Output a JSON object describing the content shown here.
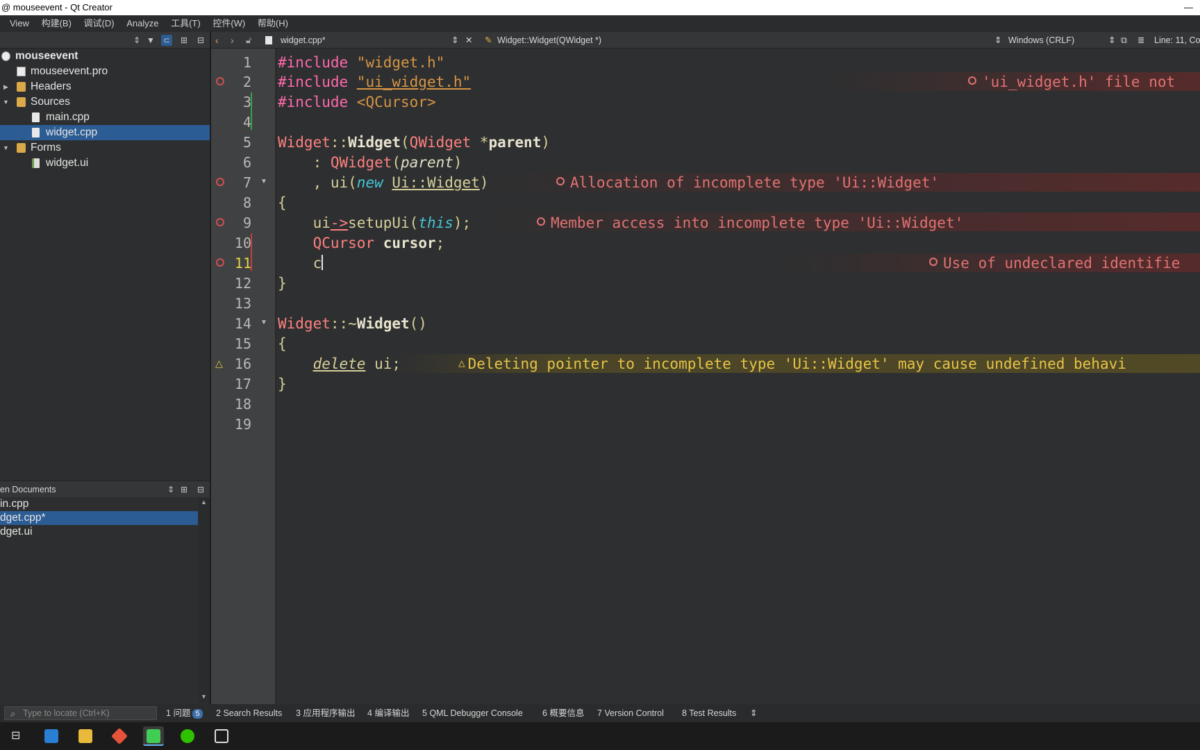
{
  "window": {
    "title": "@ mouseevent - Qt Creator"
  },
  "menu": [
    "View",
    "构建(B)",
    "调试(D)",
    "Analyze",
    "工具(T)",
    "控件(W)",
    "帮助(H)"
  ],
  "project_tree": [
    {
      "label": "mouseevent",
      "bold": true
    },
    {
      "label": "mouseevent.pro"
    },
    {
      "label": "Headers"
    },
    {
      "label": "Sources"
    },
    {
      "label": "main.cpp"
    },
    {
      "label": "widget.cpp",
      "selected": true
    },
    {
      "label": "Forms"
    },
    {
      "label": "widget.ui"
    }
  ],
  "open_documents": {
    "title": "en Documents",
    "items": [
      {
        "label": "in.cpp"
      },
      {
        "label": "dget.cpp*",
        "selected": true
      },
      {
        "label": "dget.ui"
      }
    ]
  },
  "editor_toolbar": {
    "file": "widget.cpp*",
    "symbol": "Widget::Widget(QWidget *)",
    "line_ending": "Windows (CRLF)",
    "position": "Line: 11, Co"
  },
  "editor": {
    "line_numbers": [
      "1",
      "2",
      "3",
      "4",
      "5",
      "6",
      "7",
      "8",
      "9",
      "10",
      "11",
      "12",
      "13",
      "14",
      "15",
      "16",
      "17",
      "18",
      "19"
    ],
    "current_line": 11,
    "diagnostics": {
      "d2": "'ui_widget.h' file not",
      "d7": "Allocation of incomplete type 'Ui::Widget'",
      "d9": "Member access into incomplete type 'Ui::Widget'",
      "d11": "Use of undeclared identifie",
      "d16": "Deleting pointer to incomplete type 'Ui::Widget' may cause undefined behavi"
    },
    "code": {
      "l1a": "#include ",
      "l1b": "\"widget.h\"",
      "l2a": "#include ",
      "l2b": "\"ui_widget.h\"",
      "l3a": "#include ",
      "l3b": "<QCursor>",
      "l5a": "Widget",
      "l5b": "::",
      "l5c": "Widget",
      "l5d": "(",
      "l5e": "QWidget",
      "l5f": " *",
      "l5g": "parent",
      "l5h": ")",
      "l6a": "    : ",
      "l6b": "QWidget",
      "l6c": "(",
      "l6d": "parent",
      "l6e": ")",
      "l7a": "    , ui(",
      "l7b": "new",
      "l7c": " ",
      "l7d": "Ui::Widget",
      "l7e": ")",
      "l8a": "{",
      "l9a": "    ui",
      "l9b": "->",
      "l9c": "setupUi(",
      "l9d": "this",
      "l9e": ");",
      "l10a": "    ",
      "l10b": "QCursor",
      "l10c": " ",
      "l10d": "cursor",
      "l10e": ";",
      "l11a": "    c",
      "l12a": "}",
      "l14a": "Widget",
      "l14b": "::~",
      "l14c": "Widget",
      "l14d": "()",
      "l15a": "{",
      "l16a": "    ",
      "l16b": "delete",
      "l16c": " ui;",
      "l17a": "}"
    }
  },
  "locator": {
    "placeholder": "Type to locate (Ctrl+K)"
  },
  "output_tabs": [
    {
      "num": "1",
      "label": "问题",
      "badge": "5"
    },
    {
      "num": "2",
      "label": "Search Results"
    },
    {
      "num": "3",
      "label": "应用程序输出"
    },
    {
      "num": "4",
      "label": "编译输出"
    },
    {
      "num": "5",
      "label": "QML Debugger Console"
    },
    {
      "num": "6",
      "label": "概要信息"
    },
    {
      "num": "7",
      "label": "Version Control"
    },
    {
      "num": "8",
      "label": "Test Results"
    }
  ],
  "colors": {
    "error": "#e27272",
    "warning": "#e6c447",
    "selection": "#2c5c94",
    "preprocessor": "#ff6aad",
    "keyword": "#45c6d6"
  },
  "taskbar_icons": [
    "task-view-icon",
    "store-icon",
    "file-explorer-icon",
    "git-icon",
    "qt-creator-icon",
    "wechat-icon",
    "video-icon"
  ]
}
